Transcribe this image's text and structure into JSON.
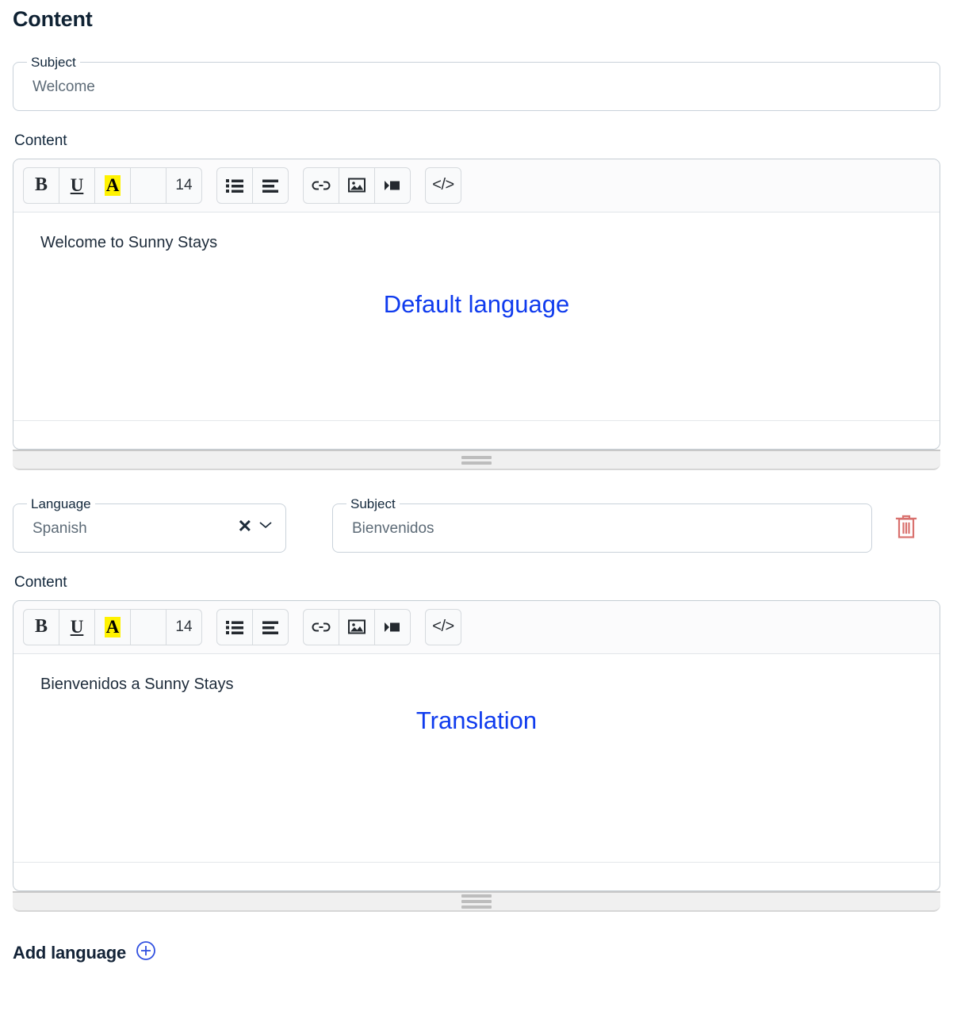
{
  "page": {
    "title": "Content"
  },
  "default_block": {
    "subject": {
      "label": "Subject",
      "value": "Welcome",
      "placeholder": "Subject"
    },
    "content_label": "Content",
    "editor": {
      "toolbar": {
        "bold": "B",
        "underline": "U",
        "highlight": "A",
        "text_color": "",
        "font_size": "14",
        "bulleted_list": "bulleted-list-icon",
        "align": "align-icon",
        "link": "link-icon",
        "image": "image-icon",
        "video": "video-icon",
        "code": "</>"
      },
      "body_text": "Welcome to Sunny Stays",
      "annotation": "Default language"
    }
  },
  "translation_block": {
    "language": {
      "label": "Language",
      "value": "Spanish",
      "clear_icon": "clear-icon",
      "chevron_icon": "chevron-down-icon"
    },
    "subject": {
      "label": "Subject",
      "value": "Bienvenidos",
      "placeholder": "Subject"
    },
    "delete_icon": "trash-icon",
    "content_label": "Content",
    "editor": {
      "toolbar": {
        "bold": "B",
        "underline": "U",
        "highlight": "A",
        "text_color": "",
        "font_size": "14",
        "bulleted_list": "bulleted-list-icon",
        "align": "align-icon",
        "link": "link-icon",
        "image": "image-icon",
        "video": "video-icon",
        "code": "</>"
      },
      "body_text": "Bienvenidos a Sunny Stays",
      "annotation": "Translation"
    }
  },
  "footer": {
    "add_language_label": "Add language",
    "add_icon": "plus-circle-icon"
  },
  "colors": {
    "annotation_blue": "#0f3bee",
    "accent_blue": "#2f4fe0",
    "delete_red": "#d9716e",
    "highlight_yellow": "#fff200",
    "text_dark": "#13283c"
  }
}
